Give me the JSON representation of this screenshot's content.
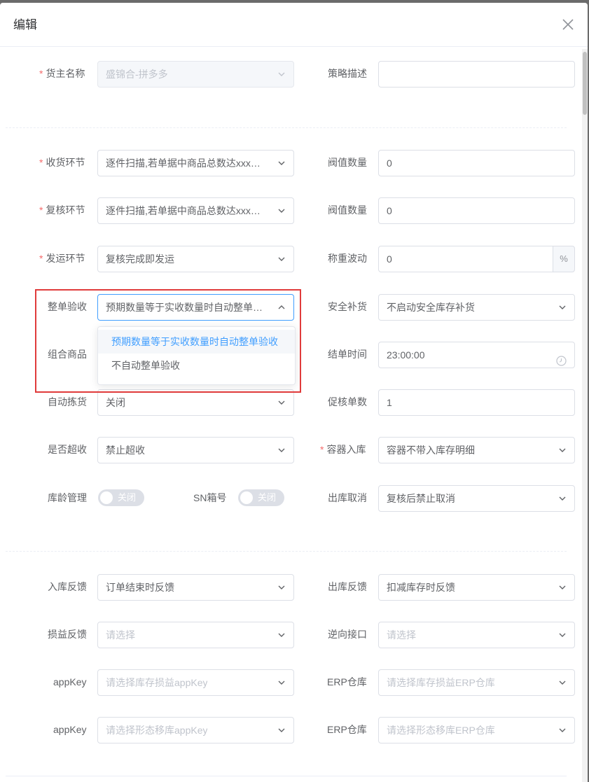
{
  "dialog": {
    "title": "编辑"
  },
  "form": {
    "owner": {
      "label": "货主名称",
      "value": "盛锦合-拼多多"
    },
    "strategy_desc": {
      "label": "策略描述",
      "value": ""
    },
    "receive": {
      "label": "收货环节",
      "value": "逐件扫描,若单据中商品总数达xxx件..."
    },
    "receive_threshold": {
      "label": "阀值数量",
      "value": "0"
    },
    "review": {
      "label": "复核环节",
      "value": "逐件扫描,若单据中商品总数达xxx件..."
    },
    "review_threshold": {
      "label": "阀值数量",
      "value": "0"
    },
    "ship": {
      "label": "发运环节",
      "value": "复核完成即发运"
    },
    "weight_tolerance": {
      "label": "称重波动",
      "value": "0",
      "suffix": "%"
    },
    "whole_accept": {
      "label": "整单验收",
      "value": "预期数量等于实收数量时自动整单验收"
    },
    "safety_replenish": {
      "label": "安全补货",
      "value": "不启动安全库存补货"
    },
    "combo_goods": {
      "label": "组合商品"
    },
    "close_time": {
      "label": "结单时间",
      "value": "23:00:00"
    },
    "auto_pick": {
      "label": "自动拣货",
      "value": "关闭"
    },
    "urge_count": {
      "label": "促核单数",
      "value": "1"
    },
    "over_receive": {
      "label": "是否超收",
      "value": "禁止超收"
    },
    "container_in": {
      "label": "容器入库",
      "value": "容器不带入库存明细"
    },
    "age_mgmt": {
      "label": "库龄管理",
      "state": "关闭"
    },
    "sn_box": {
      "label": "SN箱号",
      "state": "关闭"
    },
    "out_cancel": {
      "label": "出库取消",
      "value": "复核后禁止取消"
    },
    "in_feedback": {
      "label": "入库反馈",
      "value": "订单结束时反馈"
    },
    "out_feedback": {
      "label": "出库反馈",
      "value": "扣减库存时反馈"
    },
    "loss_feedback": {
      "label": "损益反馈",
      "placeholder": "请选择"
    },
    "reverse_api": {
      "label": "逆向接口",
      "placeholder": "请选择"
    },
    "appkey_1": {
      "label": "appKey",
      "placeholder": "请选择库存损益appKey"
    },
    "erp_1": {
      "label": "ERP仓库",
      "placeholder": "请选择库存损益ERP仓库"
    },
    "appkey_2": {
      "label": "appKey",
      "placeholder": "请选择形态移库appKey"
    },
    "erp_2": {
      "label": "ERP仓库",
      "placeholder": "请选择形态移库ERP仓库"
    }
  },
  "dropdown": {
    "options": [
      "预期数量等于实收数量时自动整单验收",
      "不自动整单验收"
    ],
    "selected_index": 0
  },
  "colors": {
    "accent": "#409eff",
    "required_star": "#f56c6c",
    "highlight_box": "#e03b3b"
  }
}
